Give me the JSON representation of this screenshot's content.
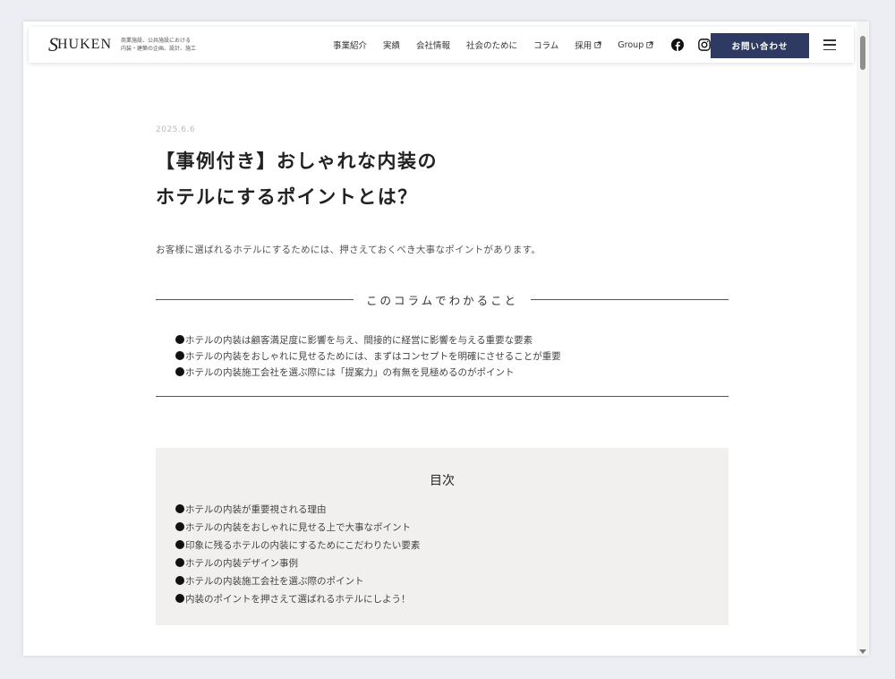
{
  "header": {
    "logo_mark": "S",
    "logo_text": "HUKEN",
    "tagline_line1": "商業施設、公共施設における",
    "tagline_line2": "内装・建築の企画、設計、施工",
    "nav": [
      {
        "label": "事業紹介"
      },
      {
        "label": "実績"
      },
      {
        "label": "会社情報"
      },
      {
        "label": "社会のために"
      },
      {
        "label": "コラム"
      },
      {
        "label": "採用"
      },
      {
        "label": "Group"
      }
    ],
    "contact_label": "お問い合わせ",
    "icons": {
      "facebook": "facebook-icon",
      "instagram": "instagram-icon",
      "menu": "hamburger-menu-icon",
      "external": "external-link-icon"
    }
  },
  "article": {
    "date": "2025.6.6",
    "title_line1": "【事例付き】おしゃれな内装の",
    "title_line2": "ホテルにするポイントとは？",
    "intro": "お客様に選ばれるホテルにするためには、押さえておくべき大事なポイントがあります。",
    "summary": {
      "title": "このコラムでわかること",
      "items": [
        "ホテルの内装は顧客満足度に影響を与え、間接的に経営に影響を与える重要な要素",
        "ホテルの内装をおしゃれに見せるためには、まずはコンセプトを明確にさせることが重要",
        "ホテルの内装施工会社を選ぶ際には「提案力」の有無を見極めるのがポイント"
      ]
    },
    "toc": {
      "title": "目次",
      "items": [
        "ホテルの内装が重要視される理由",
        "ホテルの内装をおしゃれに見せる上で大事なポイント",
        "印象に残るホテルの内装にするためにこだわりたい要素",
        "ホテルの内装デザイン事例",
        "ホテルの内装施工会社を選ぶ際のポイント",
        "内装のポイントを押さえて選ばれるホテルにしよう！"
      ]
    }
  },
  "colors": {
    "accent": "#2f3a63",
    "toc_bg": "#f1f0ee"
  }
}
